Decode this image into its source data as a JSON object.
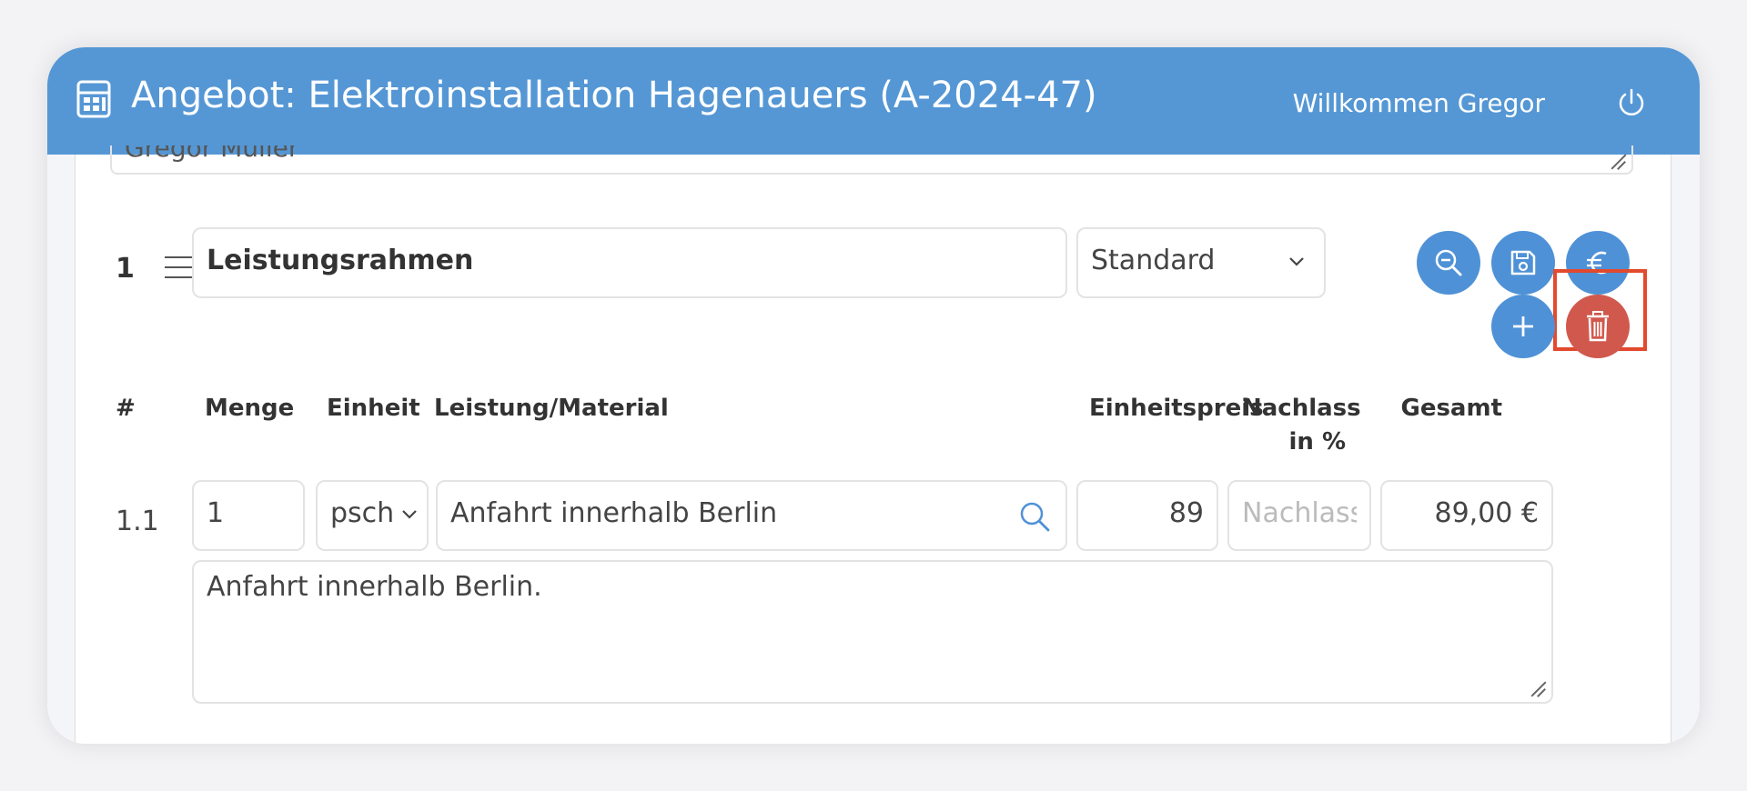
{
  "header": {
    "title": "Angebot: Elektroinstallation Hagenauers (A-2024-47)",
    "welcome": "Willkommen Gregor"
  },
  "prev_textarea": {
    "value": "Gregor Müller"
  },
  "section": {
    "number": "1",
    "title_value": "Leistungsrahmen",
    "type_select": "Standard"
  },
  "columns": {
    "number": "#",
    "quantity": "Menge",
    "unit": "Einheit",
    "service": "Leistung/Material",
    "unit_price": "Einheitspreis",
    "discount_line1": "Nachlass",
    "discount_line2": "in %",
    "total": "Gesamt"
  },
  "item": {
    "number": "1.1",
    "quantity": "1",
    "unit": "psch",
    "service": "Anfahrt innerhalb Berlin",
    "unit_price": "89",
    "discount_placeholder": "Nachlass",
    "total": "89,00 €",
    "description": "Anfahrt innerhalb Berlin."
  },
  "colors": {
    "header": "#5597d5",
    "primary_button": "#4f91d6",
    "delete_button": "#d1584d",
    "highlight": "#e2492d"
  },
  "icons": [
    "calculator-icon",
    "power-icon",
    "drag-handle-icon",
    "zoom-out-icon",
    "save-icon",
    "euro-icon",
    "plus-icon",
    "trash-icon",
    "search-icon",
    "chevron-down-icon"
  ]
}
